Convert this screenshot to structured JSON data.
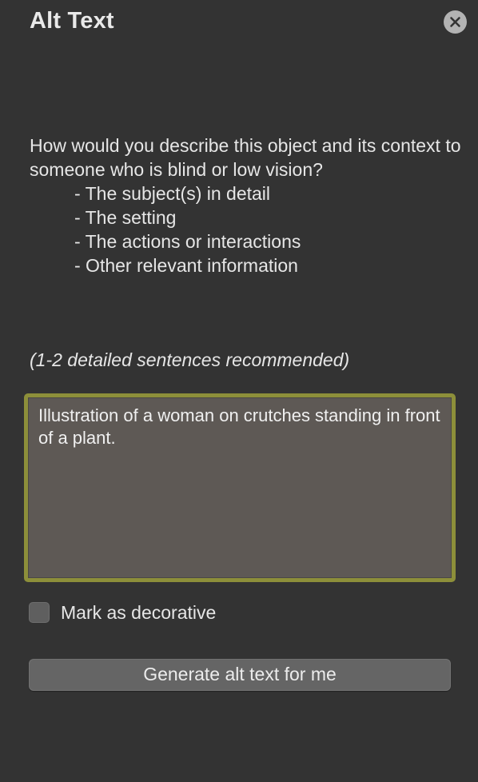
{
  "header": {
    "title": "Alt Text",
    "close_icon": "close-icon"
  },
  "prompt": {
    "question": "How would you describe this object and its context to someone who is blind or low vision?",
    "bullets": [
      "- The subject(s) in detail",
      "- The setting",
      "- The actions or interactions",
      "- Other relevant information"
    ],
    "recommendation": "(1-2 detailed sentences recommended)"
  },
  "alt_text_field": {
    "value": "Illustration of a woman on crutches standing in front of a plant.",
    "focus_ring_color": "#8d8f3a"
  },
  "decorative": {
    "label": "Mark as decorative",
    "checked": false
  },
  "generate_button": {
    "label": "Generate alt text for me"
  },
  "colors": {
    "background": "#333333",
    "text": "#e6e6e6",
    "field_background": "#5e5955"
  }
}
